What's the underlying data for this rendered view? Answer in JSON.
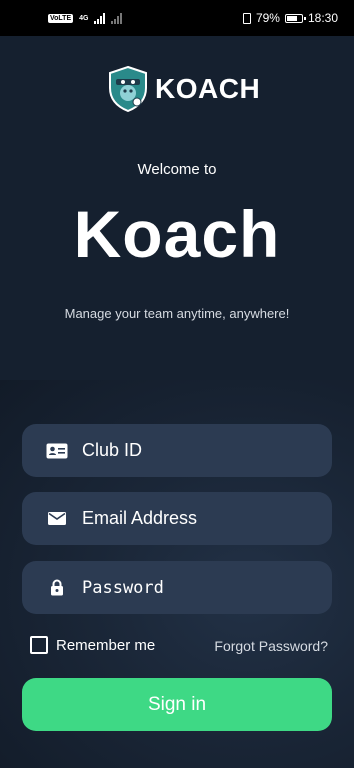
{
  "status_bar": {
    "network_badge": "VoLTE",
    "network_type": "4G",
    "battery_percent": "79%",
    "battery_level": 0.79,
    "time": "18:30"
  },
  "brand": {
    "logo_text": "KOACH",
    "welcome": "Welcome to",
    "title": "Koach",
    "subtitle": "Manage your team anytime, anywhere!"
  },
  "form": {
    "club_id": {
      "value": "",
      "placeholder": "Club ID"
    },
    "email": {
      "value": "",
      "placeholder": "Email Address"
    },
    "password": {
      "value": "",
      "placeholder": "Password"
    },
    "remember_label": "Remember me",
    "remember_checked": false,
    "forgot_label": "Forgot Password?",
    "signin_label": "Sign in"
  },
  "colors": {
    "background": "#15202f",
    "field_bg": "#2c3b52",
    "accent": "#3ed985"
  },
  "icons": {
    "logo": "koach-shield-logo",
    "club_id": "id-card-icon",
    "email": "mail-icon",
    "password": "lock-icon"
  }
}
